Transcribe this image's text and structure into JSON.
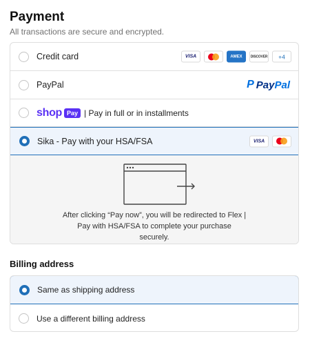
{
  "payment": {
    "title": "Payment",
    "subtitle": "All transactions are secure and encrypted.",
    "options": [
      {
        "label": "Credit card",
        "selected": false
      },
      {
        "label": "PayPal",
        "selected": false
      },
      {
        "label": "| Pay in full or in installments",
        "selected": false
      },
      {
        "label": "Sika - Pay with your HSA/FSA",
        "selected": true
      }
    ],
    "credit_cards": {
      "visa": "VISA",
      "amex": "AMEX",
      "discover": "DISCOVER",
      "more": "+4"
    },
    "paypal_logo": {
      "pay": "Pay",
      "pal": "Pal",
      "mark": "P"
    },
    "shop_pay": {
      "shop": "shop",
      "pay": "Pay"
    },
    "sika_cards": {
      "visa": "VISA"
    },
    "redirect_text": "After clicking “Pay now”, you will be redirected to Flex | Pay with HSA/FSA to complete your purchase securely.",
    "icons": [
      "radio-icon",
      "visa-icon",
      "mastercard-icon",
      "amex-icon",
      "discover-icon",
      "paypal-logo",
      "shop-pay-logo",
      "browser-redirect-icon"
    ]
  },
  "billing": {
    "title": "Billing address",
    "options": [
      {
        "label": "Same as shipping address",
        "selected": true
      },
      {
        "label": "Use a different billing address",
        "selected": false
      }
    ]
  },
  "colors": {
    "accent": "#1f6fb8",
    "selected_bg": "#eef4fc",
    "shop_purple": "#5a31f4"
  }
}
